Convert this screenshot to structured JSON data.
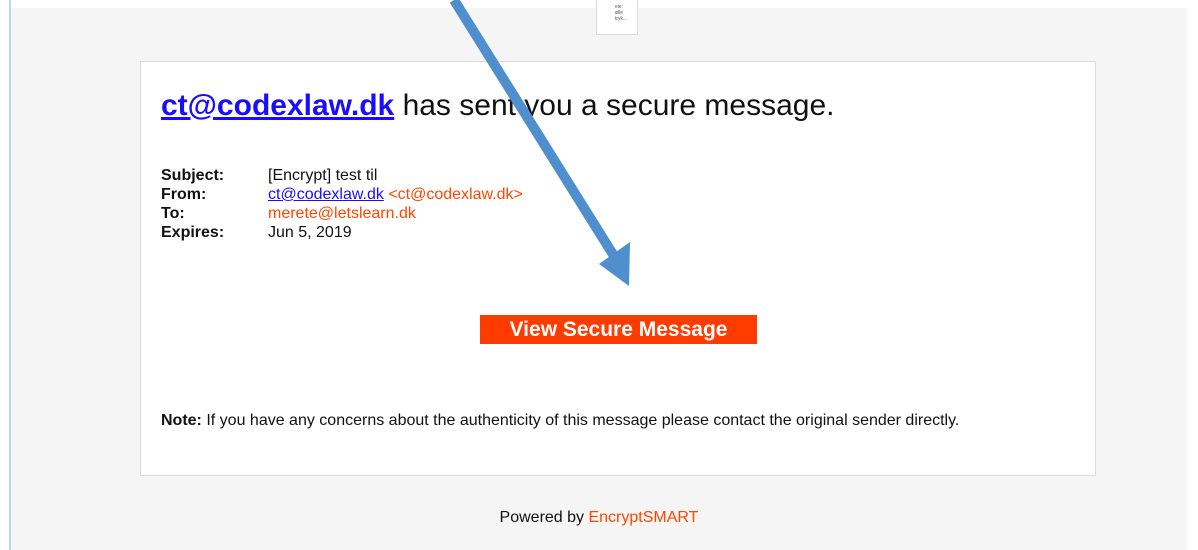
{
  "thumbnail": {
    "lines": [
      "eie:",
      "ølle",
      "tryk..."
    ]
  },
  "message": {
    "sender_email": "ct@codexlaw.dk",
    "headline_rest": "has sent you a secure message.",
    "fields": {
      "subject_label": "Subject:",
      "subject_value": "[Encrypt] test til",
      "from_label": "From:",
      "from_name": "ct@codexlaw.dk",
      "from_address": "<ct@codexlaw.dk>",
      "to_label": "To:",
      "to_value": "merete@letslearn.dk",
      "expires_label": "Expires:",
      "expires_value": "Jun 5, 2019"
    },
    "view_button": "View Secure Message",
    "note_label": "Note:",
    "note_text": " If you have any concerns about the authenticity of this message please contact the original sender directly."
  },
  "footer": {
    "prefix": "Powered by ",
    "brand": "EncryptSMART"
  },
  "colors": {
    "link": "#1a0dff",
    "brand_orange": "#ff4700",
    "button_bg": "#ff3b00",
    "annotation_arrow": "#4f8fce"
  }
}
